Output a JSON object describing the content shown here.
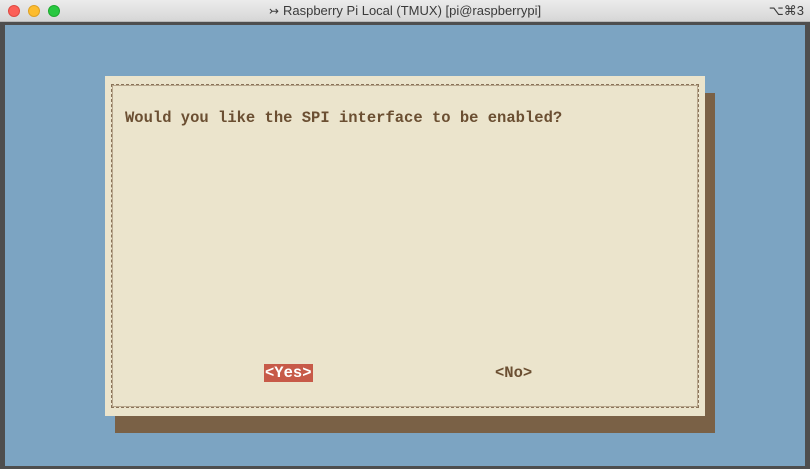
{
  "window": {
    "title": "Raspberry Pi Local (TMUX) [pi@raspberrypi]",
    "title_prefix_glyph": "↣",
    "shortcut": "⌥⌘3"
  },
  "dialog": {
    "question": "Would you like the SPI interface to be enabled?",
    "yes_label": "<Yes>",
    "no_label": "<No>",
    "selected_button": "yes"
  },
  "colors": {
    "terminal_background": "#7ca4c2",
    "dialog_background": "#ebe4cc",
    "dialog_shadow": "#7a6146",
    "text": "#6b4f32",
    "selected_button_background": "#c75a48",
    "selected_button_text": "#ffffff"
  },
  "icons": {
    "close": "close-icon",
    "minimize": "minimize-icon",
    "zoom": "zoom-icon",
    "title_prefix": "terminal-arrow-icon"
  }
}
